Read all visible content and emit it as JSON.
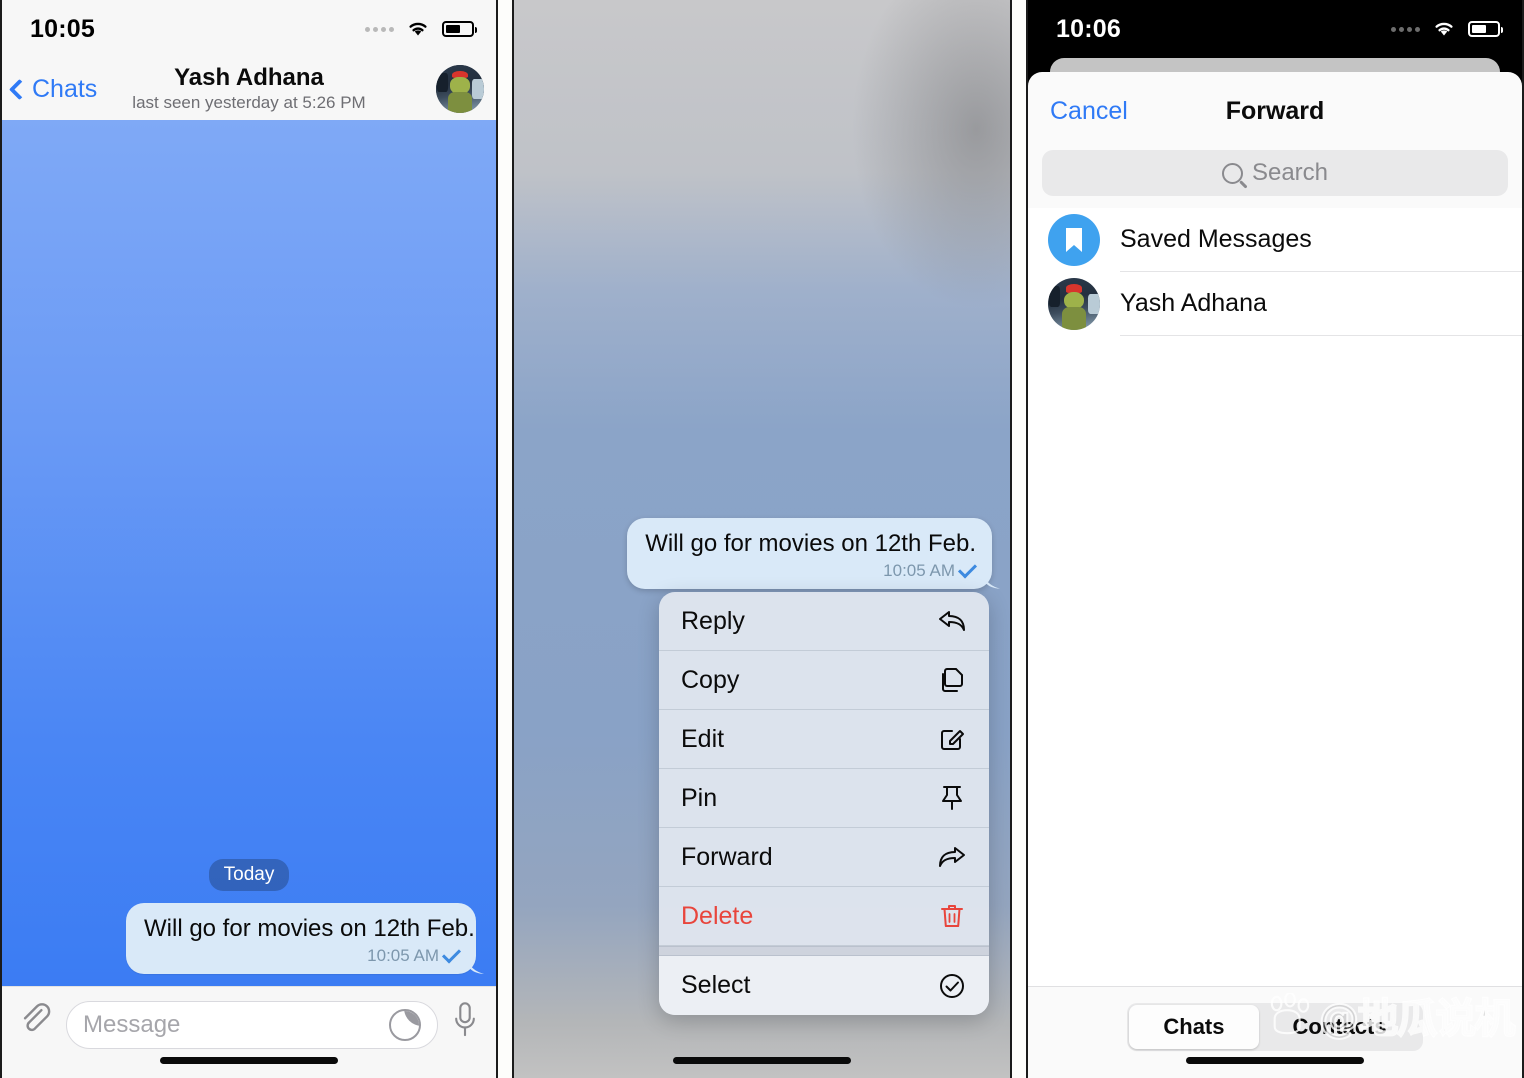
{
  "panels": {
    "chat": {
      "status": {
        "time": "10:05"
      },
      "header": {
        "back_label": "Chats",
        "title": "Yash Adhana",
        "subtitle": "last seen yesterday at 5:26 PM",
        "back_icon": "chevron-left-icon",
        "avatar_name": "avatar"
      },
      "date_separator": "Today",
      "message": {
        "text": "Will go for movies on 12th Feb.",
        "time": "10:05 AM",
        "status_icon": "single-check-icon"
      },
      "input": {
        "placeholder": "Message",
        "attach_icon": "paperclip-icon",
        "sticker_icon": "sticker-icon",
        "mic_icon": "microphone-icon"
      }
    },
    "context_menu": {
      "message": {
        "text": "Will go for movies on 12th Feb.",
        "time": "10:05 AM",
        "status_icon": "single-check-icon"
      },
      "items": [
        {
          "label": "Reply",
          "icon": "reply-arrow-icon",
          "danger": false
        },
        {
          "label": "Copy",
          "icon": "copy-icon",
          "danger": false
        },
        {
          "label": "Edit",
          "icon": "pencil-square-icon",
          "danger": false
        },
        {
          "label": "Pin",
          "icon": "pin-icon",
          "danger": false
        },
        {
          "label": "Forward",
          "icon": "forward-arrow-icon",
          "danger": false
        },
        {
          "label": "Delete",
          "icon": "trash-icon",
          "danger": true
        },
        {
          "label": "Select",
          "icon": "check-circle-icon",
          "danger": false
        }
      ]
    },
    "forward": {
      "status": {
        "time": "10:06"
      },
      "sheet": {
        "cancel_label": "Cancel",
        "title": "Forward",
        "search_placeholder": "Search",
        "search_icon": "search-icon"
      },
      "rows": [
        {
          "label": "Saved Messages",
          "icon": "bookmark-icon",
          "kind": "saved"
        },
        {
          "label": "Yash Adhana",
          "icon": "avatar",
          "kind": "contact"
        }
      ],
      "segments": [
        {
          "label": "Chats",
          "active": true
        },
        {
          "label": "Contacts",
          "active": false
        }
      ]
    }
  },
  "watermark": {
    "text": "@地瓜说机",
    "logo": "baidu-paw-icon"
  },
  "colors": {
    "accent_blue": "#2f7af6",
    "bubble": "#d9e9f8",
    "danger_red": "#e8453c",
    "saved_badge": "#3fa2ef"
  }
}
